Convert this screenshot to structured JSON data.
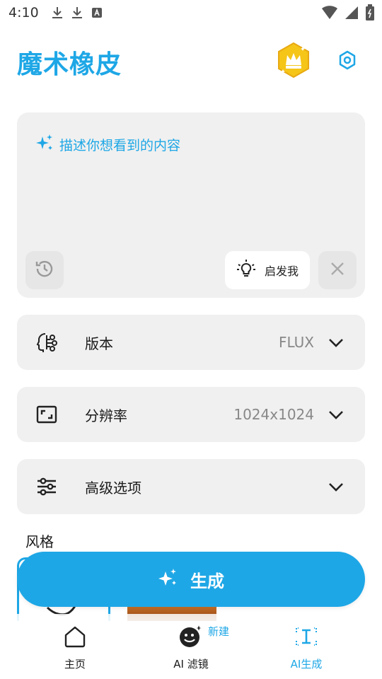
{
  "status_bar": {
    "time": "4:10"
  },
  "header": {
    "title": "魔术橡皮"
  },
  "prompt": {
    "placeholder": "描述你想看到的内容",
    "inspire_label": "启发我"
  },
  "options": [
    {
      "label": "版本",
      "value": "FLUX"
    },
    {
      "label": "分辨率",
      "value": "1024x1024"
    },
    {
      "label": "高级选项",
      "value": ""
    }
  ],
  "styles": {
    "section_title": "风格"
  },
  "generate": {
    "label": "生成"
  },
  "bottom_nav": {
    "items": [
      {
        "label": "主页",
        "active": false
      },
      {
        "label": "AI 滤镜",
        "active": false
      },
      {
        "label": "AI生成",
        "active": true
      }
    ],
    "new_badge": "新建"
  },
  "colors": {
    "accent": "#1ea7e6",
    "card_bg": "#f0f0f0",
    "badge_gold": "#f5c518"
  }
}
